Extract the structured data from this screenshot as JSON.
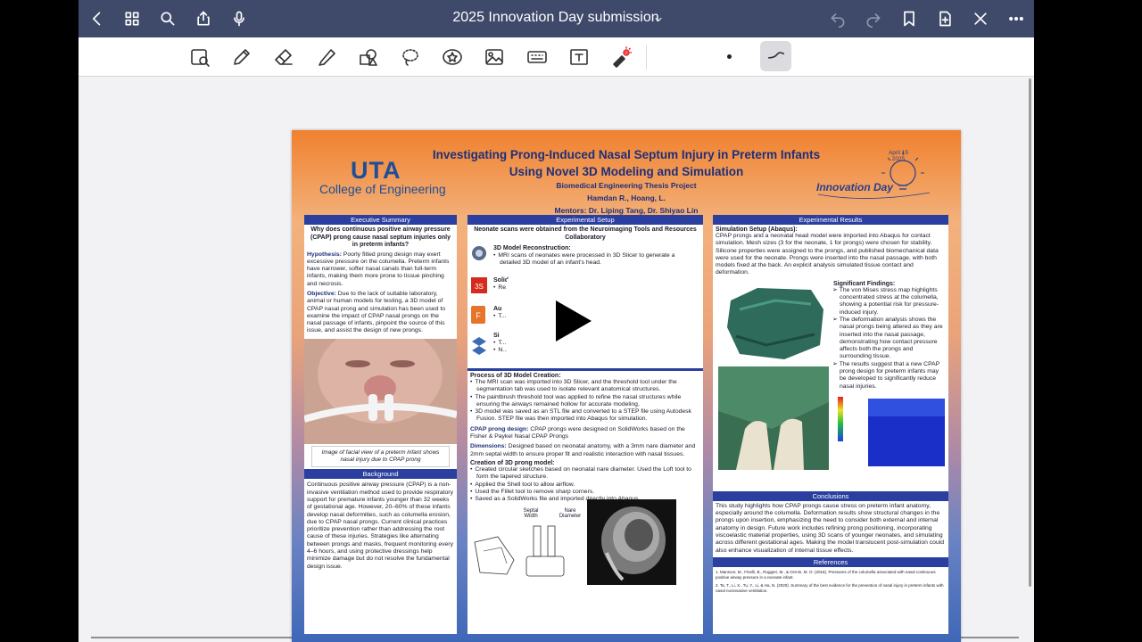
{
  "topbar": {
    "title": "2025 Innovation Day submission",
    "icons": [
      "chevron-left-icon",
      "grid-icon",
      "search-icon",
      "share-icon",
      "microphone-icon",
      "undo-icon",
      "redo-icon",
      "bookmark-icon",
      "add-page-icon",
      "close-x-icon",
      "more-icon"
    ]
  },
  "toolbar": {
    "tools": [
      "zoom-select-icon",
      "pen-icon",
      "eraser-icon",
      "highlighter-icon",
      "shapes-icon",
      "lasso-icon",
      "sticker-icon",
      "image-icon",
      "keyboard-icon",
      "text-box-icon",
      "laser-pointer-icon"
    ]
  },
  "poster": {
    "logo": "UTA",
    "college": "College of Engineering",
    "title_line1": "Investigating Prong-Induced Nasal Septum Injury in Preterm Infants",
    "title_line2": "Using Novel 3D Modeling and Simulation",
    "subtitle_line1": "Biomedical Engineering Thesis Project",
    "subtitle_line2": "Hamdan R., Hoang, L.",
    "subtitle_line3": "Mentors: Dr. Liping Tang, Dr. Shiyao Lin",
    "badge_text": "Innovation Day",
    "badge_date": "April 15 2025",
    "col1": {
      "exec_head": "Executive Summary",
      "question": "Why does continuous positive airway pressure (CPAP) prong cause nasal septum injuries only in preterm infants?",
      "hyp_label": "Hypothesis:",
      "hyp_text": " Poorly fitted prong design may exert excessive pressure on the columella. Preterm infants have narrower, softer nasal canals than full-term infants, making them more prone to tissue pinching and necrosis.",
      "obj_label": "Objective:",
      "obj_text": " Due to the lack of suitable laboratory, animal or human models for testing, a 3D model of CPAP nasal prong and simulation has been used to examine the impact of CPAP nasal prongs on the nasal passage of infants, pinpoint the source of this issue, and assist the design of new prongs.",
      "caption": "Image of facial view of a preterm infant shows nasal injury due to CPAP prong",
      "bg_head": "Background",
      "bg_text": "Continuous positive airway pressure (CPAP) is a non-invasive ventilation method used to provide respiratory support for premature infants younger than 32 weeks of gestational age. However, 20–60% of these infants develop nasal deformities, such as columella erosion, due to CPAP nasal prongs. Current clinical practices prioritize prevention rather than addressing the root cause of these injuries. Strategies like alternating between prongs and masks, frequent monitoring every 4–6 hours, and using protective dressings help minimize damage but do not resolve the fundamental design issue."
    },
    "col2": {
      "head": "Experimental Setup",
      "intro": "Neonate scans were obtained from the Neuroimaging Tools and Resources Collaboratory",
      "recon_label": "3D Model Reconstruction:",
      "recon_item": "MRI scans of neonates were processed in 3D Slicer to generate a detailed 3D model of an infant's head.",
      "sw_label": "SolidWorks Design:",
      "sw_item": "Re... created using S...",
      "au_label": "Au",
      "au_item": "T... nd converted into a ...",
      "si_label": "Si",
      "si_item1": "T... imported into",
      "si_item2": "N... geways of the 3D h...",
      "process_label": "Process of 3D Model Creation:",
      "process_items": [
        "The MRI scan was imported into 3D Slicer, and the threshold tool under the segmentation tab was used to isolate relevant anatomical structures.",
        "The paintbrush threshold tool was applied to refine the nasal structures while ensuring the airways remained hollow for accurate modeling.",
        "3D model was saved as an STL file and converted to a STEP file using Autodesk Fusion. STEP file was then imported into Abaqus for simulation."
      ],
      "cpap_label": "CPAP prong design:",
      "cpap_text": " CPAP prongs were designed on SolidWorks based on the Fisher & Paykel Nasal CPAP Prongs",
      "dim_label": "Dimensions:",
      "dim_text": " Designed based on neonatal anatomy, with a 3mm nare diameter and 2mm septal width to ensure proper fit and realistic interaction with nasal tissues.",
      "creation_label": "Creation of 3D prong model:",
      "creation_items": [
        "Created circular sketches based on neonatal nare diameter. Used the Loft tool to form the tapered structure.",
        "Applied the Shell tool to allow airflow.",
        "Used the Fillet tool to remove sharp corners.",
        "Saved as a SolidWorks file and imported directly into Abaqus."
      ],
      "label_septal": "Septal Width",
      "label_nare": "Nare Diameter"
    },
    "col3": {
      "head": "Experimental Results",
      "sim_label": "Simulation Setup (Abaqus):",
      "sim_text": "CPAP prongs and a neonatal head model were imported into Abaqus for contact simulation. Mesh sizes (3 for the neonate, 1 for prongs) were chosen for stability. Silicone properties were assigned to the prongs, and published biomechanical data were used for the neonate. Prongs were inserted into the nasal passage, with both models fixed at the back. An explicit analysis simulated tissue contact and deformation.",
      "findings_label": "Significant Findings:",
      "findings": [
        "The von Mises stress map highlights concentrated stress at the columella, showing a potential risk for pressure-induced injury.",
        "The deformation analysis shows the nasal prongs being altered as they are inserted into the nasal passage, demonstrating how contact pressure affects both the prongs and surrounding tissue.",
        "The results suggest that a new CPAP prong design for preterm infants may be developed to significantly reduce nasal injuries."
      ],
      "conc_head": "Conclusions",
      "conc_text": "This study highlights how CPAP prongs cause stress on preterm infant anatomy, especially around the columella. Deformation results show structural changes in the prongs upon insertion, emphasizing the need to consider both external and internal anatomy in design. Future work includes refining prong positioning, incorporating viscoelastic material properties, using 3D scans of younger neonates, and simulating across different gestational ages. Making the model translucent post-simulation could also enhance visualization of internal tissue effects.",
      "ref_head": "References",
      "ref1": "1. Mansoor, M., Finelli, B., Ruggeri, M., & Ozmin, M. O. (2016). Pressures of the columella associated with nasal continuous positive airway pressure in a neonate infant.",
      "ref2": "2. Ta, T., Li, X., Tu, Y., Li, & Ha, N. (2020). Summary of the best evidence for the prevention of nasal injury in preterm infants with nasal noninvasive ventilation."
    }
  },
  "colors": {
    "topbar": "#3f4a6a",
    "poster_head": "#2a3fa0",
    "uta_blue": "#1d4e9a"
  }
}
